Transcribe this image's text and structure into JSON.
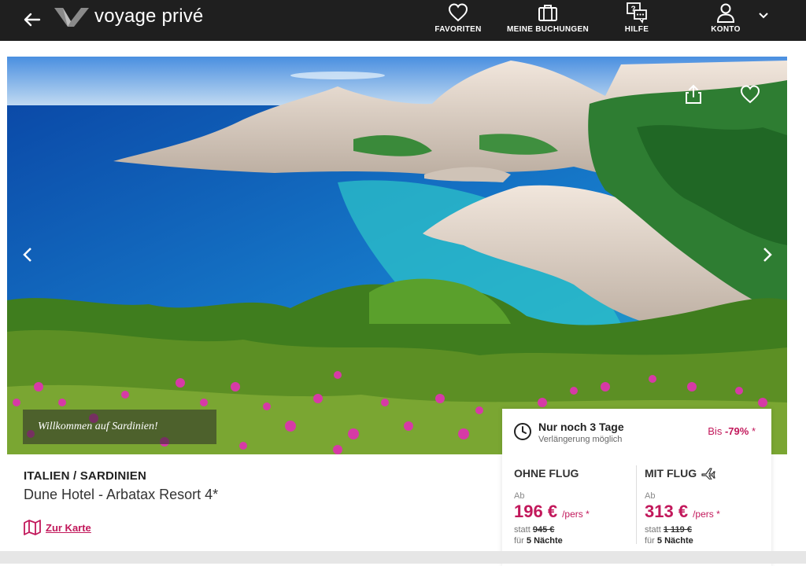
{
  "header": {
    "logo_text": "voyage privé",
    "nav": [
      {
        "label": "FAVORITEN",
        "icon": "heart-icon"
      },
      {
        "label": "MEINE BUCHUNGEN",
        "icon": "suitcase-icon"
      },
      {
        "label": "HILFE",
        "icon": "help-chat-icon"
      },
      {
        "label": "KONTO",
        "icon": "user-icon"
      }
    ]
  },
  "hero": {
    "caption": "Willkommen auf Sardinien!"
  },
  "offer": {
    "region": "ITALIEN / SARDINIEN",
    "hotel": "Dune Hotel - Arbatax Resort 4*",
    "map_link": "Zur Karte"
  },
  "card": {
    "days_left": "Nur noch 3 Tage",
    "extension": "Verlängerung möglich",
    "discount_prefix": "Bis",
    "discount_value": "-79%",
    "discount_suffix": "*",
    "without_flight": {
      "title": "OHNE FLUG",
      "from": "Ab",
      "price": "196 €",
      "per": "/pers *",
      "instead_label": "statt",
      "instead_price": "945 €",
      "for_label": "für",
      "nights": "5 Nächte"
    },
    "with_flight": {
      "title": "MIT FLUG",
      "from": "Ab",
      "price": "313 €",
      "per": "/pers *",
      "instead_label": "statt",
      "instead_price": "1 119 €",
      "for_label": "für",
      "nights": "5 Nächte"
    }
  },
  "colors": {
    "header_bg": "#1f1f1f",
    "accent": "#c2185b"
  }
}
